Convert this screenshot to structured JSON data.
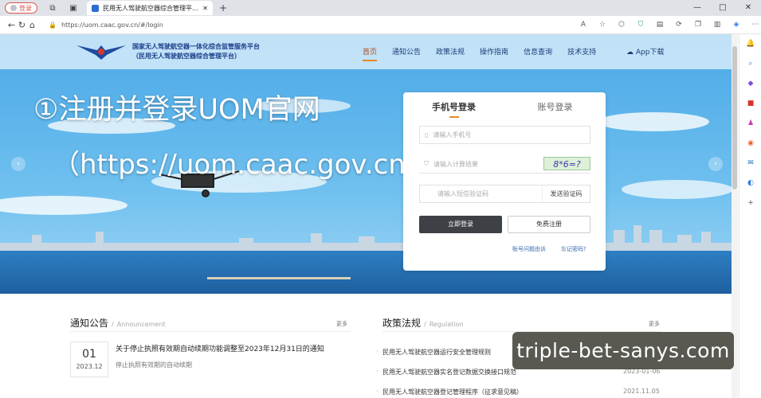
{
  "browser": {
    "profile_label": "登录",
    "tab_title": "民用无人驾驶航空器综合管理平...",
    "url": "https://uom.caac.gov.cn/#/login",
    "new_tab": "+",
    "read_aloud": "A",
    "min": "—",
    "max": "□",
    "close": "✕"
  },
  "header": {
    "title_line1": "国家无人驾驶航空器一体化综合监管服务平台",
    "title_line2": "（民用无人驾驶航空器综合管理平台）",
    "nav": [
      "首页",
      "通知公告",
      "政策法规",
      "操作指南",
      "信息查询",
      "技术支持"
    ],
    "app": "App下载"
  },
  "overlay": {
    "line1": "①注册并登录UOM官网",
    "line2": "（https://uom.caac.gov.cn/）"
  },
  "login": {
    "tab_phone": "手机号登录",
    "tab_account": "账号登录",
    "phone_placeholder": "请输入手机号",
    "calc_placeholder": "请输入计算结果",
    "captcha": "8*6=?",
    "sms_placeholder": "请输入短信验证码",
    "send_code": "发送验证码",
    "login_button": "立即登录",
    "register_button": "免费注册",
    "account_issue": "账号问题由诉",
    "forgot": "忘记密码?"
  },
  "notice": {
    "title": "通知公告",
    "subtitle": "Announcement",
    "more": "更多",
    "item": {
      "day": "01",
      "ym": "2023.12",
      "title": "关于停止执照有效期自动续期功能调整至2023年12月31日的通知",
      "desc": "停止执照有效期的自动续期"
    }
  },
  "policy": {
    "title": "政策法规",
    "subtitle": "Regulation",
    "more": "更多",
    "items": [
      {
        "title": "民用无人驾驶航空器运行安全管理规则",
        "date": ""
      },
      {
        "title": "民用无人驾驶航空器实名登记数据交换接口规范",
        "date": "2023-01-06"
      },
      {
        "title": "民用无人驾驶航空器登记管理程序（征求意见稿）",
        "date": "2021.11.05"
      }
    ]
  },
  "watermark": "triple-bet-sanys.com"
}
